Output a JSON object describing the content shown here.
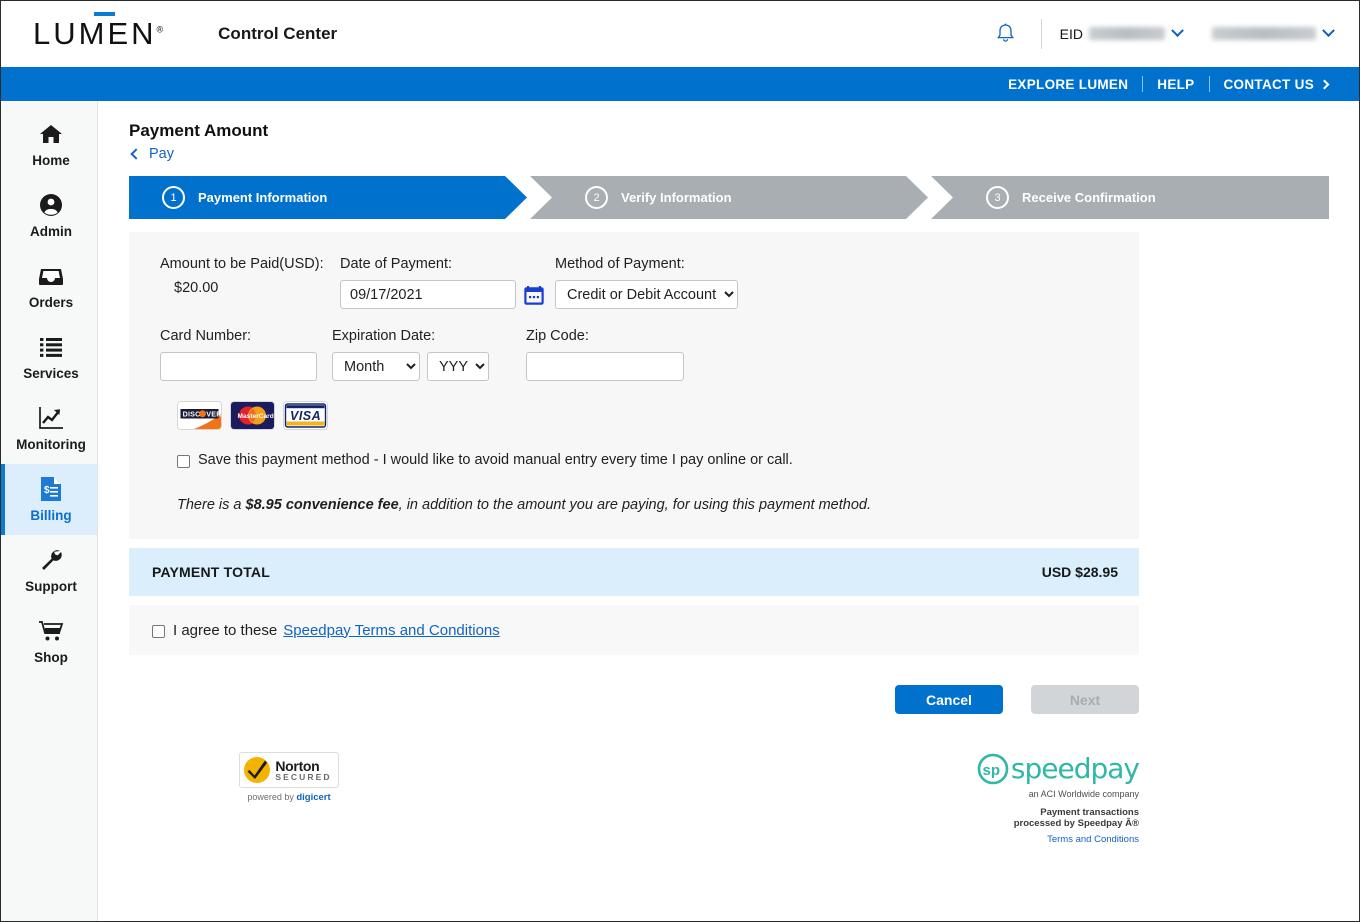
{
  "header": {
    "logo_text": "LUMEN",
    "logo_registered": "®",
    "app_title": "Control Center",
    "bell_icon": "notification-bell-icon",
    "eid_label": "EID",
    "eid_value": "",
    "user_value": ""
  },
  "nav": {
    "items": [
      {
        "label": "EXPLORE LUMEN"
      },
      {
        "label": "HELP"
      },
      {
        "label": "CONTACT US"
      }
    ]
  },
  "sidebar": {
    "items": [
      {
        "label": "Home",
        "icon": "home-icon",
        "active": false
      },
      {
        "label": "Admin",
        "icon": "user-circle-icon",
        "active": false
      },
      {
        "label": "Orders",
        "icon": "inbox-icon",
        "active": false
      },
      {
        "label": "Services",
        "icon": "list-icon",
        "active": false
      },
      {
        "label": "Monitoring",
        "icon": "chart-line-icon",
        "active": false
      },
      {
        "label": "Billing",
        "icon": "invoice-icon",
        "active": true
      },
      {
        "label": "Support",
        "icon": "wrench-icon",
        "active": false
      },
      {
        "label": "Shop",
        "icon": "cart-icon",
        "active": false
      }
    ]
  },
  "main": {
    "page_title": "Payment Amount",
    "breadcrumb_label": "Pay",
    "steps": [
      {
        "number": "1",
        "label": "Payment Information",
        "state": "active"
      },
      {
        "number": "2",
        "label": "Verify Information",
        "state": "inactive"
      },
      {
        "number": "3",
        "label": "Receive Confirmation",
        "state": "inactive"
      }
    ],
    "form": {
      "amount_label": "Amount to be Paid(USD):",
      "amount_value": "$20.00",
      "date_label": "Date of Payment:",
      "date_value": "09/17/2021",
      "calendar_icon": "calendar-icon",
      "method_label": "Method of Payment:",
      "method_value": "Credit or Debit Account",
      "method_options": [
        "Credit or Debit Account"
      ],
      "card_label": "Card Number:",
      "card_value": "",
      "card_placeholder": "",
      "exp_label": "Expiration Date:",
      "exp_month_value": "Month",
      "exp_month_options": [
        "Month"
      ],
      "exp_year_value": "YYYY",
      "exp_year_options": [
        "YYYY"
      ],
      "zip_label": "Zip Code:",
      "zip_value": "",
      "zip_placeholder": "",
      "card_logos": [
        {
          "name": "discover-card-logo",
          "label": "DISCOVER"
        },
        {
          "name": "mastercard-card-logo",
          "label": "MasterCard"
        },
        {
          "name": "visa-card-logo",
          "label": "VISA"
        }
      ],
      "save_method_label": "Save this payment method - I would like to avoid manual entry every time I pay online or call.",
      "save_method_checked": false,
      "fee_prefix": "There is a ",
      "fee_amount": "$8.95 convenience fee",
      "fee_suffix": ", in addition to the amount you are paying, for using this payment method."
    },
    "total": {
      "label": "PAYMENT TOTAL",
      "value": "USD $28.95"
    },
    "agree": {
      "checked": false,
      "text": "I agree to these",
      "link_label": "Speedpay Terms and Conditions"
    },
    "buttons": {
      "cancel_label": "Cancel",
      "next_label": "Next"
    }
  },
  "footer": {
    "norton": {
      "title": "Norton",
      "subtitle": "SECURED",
      "powered_prefix": "powered by ",
      "powered_brand": "digicert"
    },
    "speedpay": {
      "wordmark": "speedpay",
      "tagline": "an ACI Worldwide company",
      "line1": "Payment transactions",
      "line2": "processed by Speedpay Â®",
      "terms_label": "Terms and Conditions"
    }
  },
  "colors": {
    "brand_blue": "#0072ce",
    "link_blue": "#1264c4",
    "step_inactive": "#a9aeb2",
    "total_bar": "#dbeefb",
    "speedpay_teal": "#2fb7a8"
  }
}
